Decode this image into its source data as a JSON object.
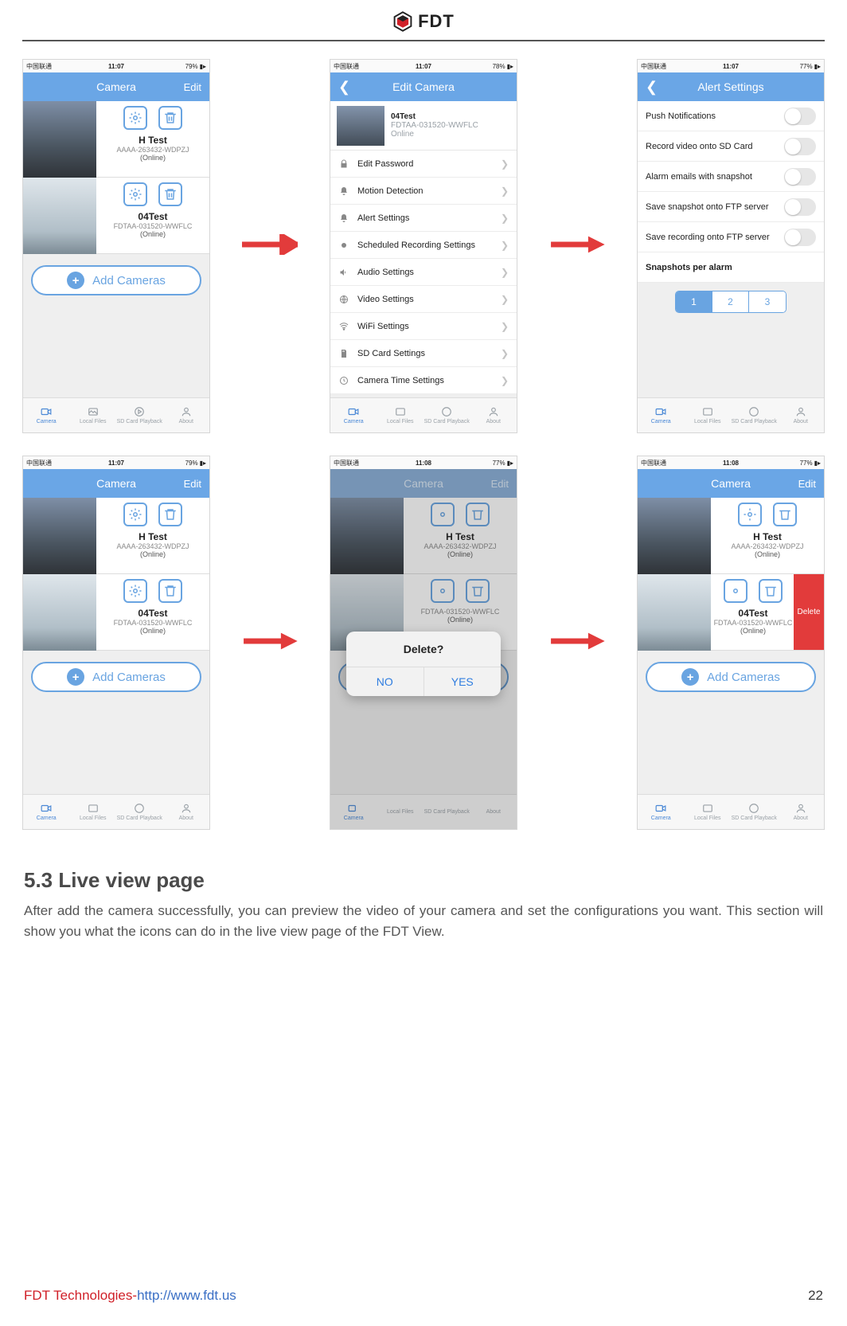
{
  "brand": {
    "name": "FDT"
  },
  "footer": {
    "company": "FDT Technologies-",
    "url": "http://www.fdt.us",
    "page": "22"
  },
  "section": {
    "heading": "5.3 Live view page",
    "paragraph": "After add the camera successfully, you can preview the video of your camera and set the configurations you want. This section will show you what the icons can do in the live view page of the FDT View."
  },
  "common": {
    "tabs": [
      "Camera",
      "Local Files",
      "SD Card Playback",
      "About"
    ],
    "carrier": "中国联通",
    "add_label": "Add Cameras"
  },
  "screens": {
    "camlist_a": {
      "time": "11:07",
      "battery": "79%",
      "nav": {
        "title": "Camera",
        "right": "Edit"
      },
      "cams": [
        {
          "name": "H Test",
          "id": "AAAA-263432-WDPZJ",
          "status": "(Online)"
        },
        {
          "name": "04Test",
          "id": "FDTAA-031520-WWFLC",
          "status": "(Online)"
        }
      ]
    },
    "editcam": {
      "time": "11:07",
      "battery": "78%",
      "nav": {
        "title": "Edit Camera"
      },
      "top": {
        "name": "04Test",
        "id": "FDTAA-031520-WWFLC",
        "status": "Online"
      },
      "rows": [
        "Edit Password",
        "Motion Detection",
        "Alert Settings",
        "Scheduled Recording Settings",
        "Audio Settings",
        "Video Settings",
        "WiFi Settings",
        "SD Card Settings",
        "Camera Time Settings"
      ]
    },
    "alert": {
      "time": "11:07",
      "battery": "77%",
      "nav": {
        "title": "Alert Settings"
      },
      "rows": [
        "Push Notifications",
        "Record video onto SD Card",
        "Alarm emails with snapshot",
        "Save snapshot onto FTP server",
        "Save recording onto FTP server"
      ],
      "snaps_label": "Snapshots per alarm",
      "seg": [
        "1",
        "2",
        "3"
      ]
    },
    "camlist_b": {
      "time": "11:07",
      "battery": "79%",
      "nav": {
        "title": "Camera",
        "right": "Edit"
      }
    },
    "delete_dialog": {
      "time": "11:08",
      "battery": "77%",
      "nav": {
        "title": "Camera",
        "right": "Edit"
      },
      "title": "Delete?",
      "no": "NO",
      "yes": "YES"
    },
    "delete_swipe": {
      "time": "11:08",
      "battery": "77%",
      "nav": {
        "title": "Camera",
        "right": "Edit"
      },
      "delete_label": "Delete"
    }
  }
}
